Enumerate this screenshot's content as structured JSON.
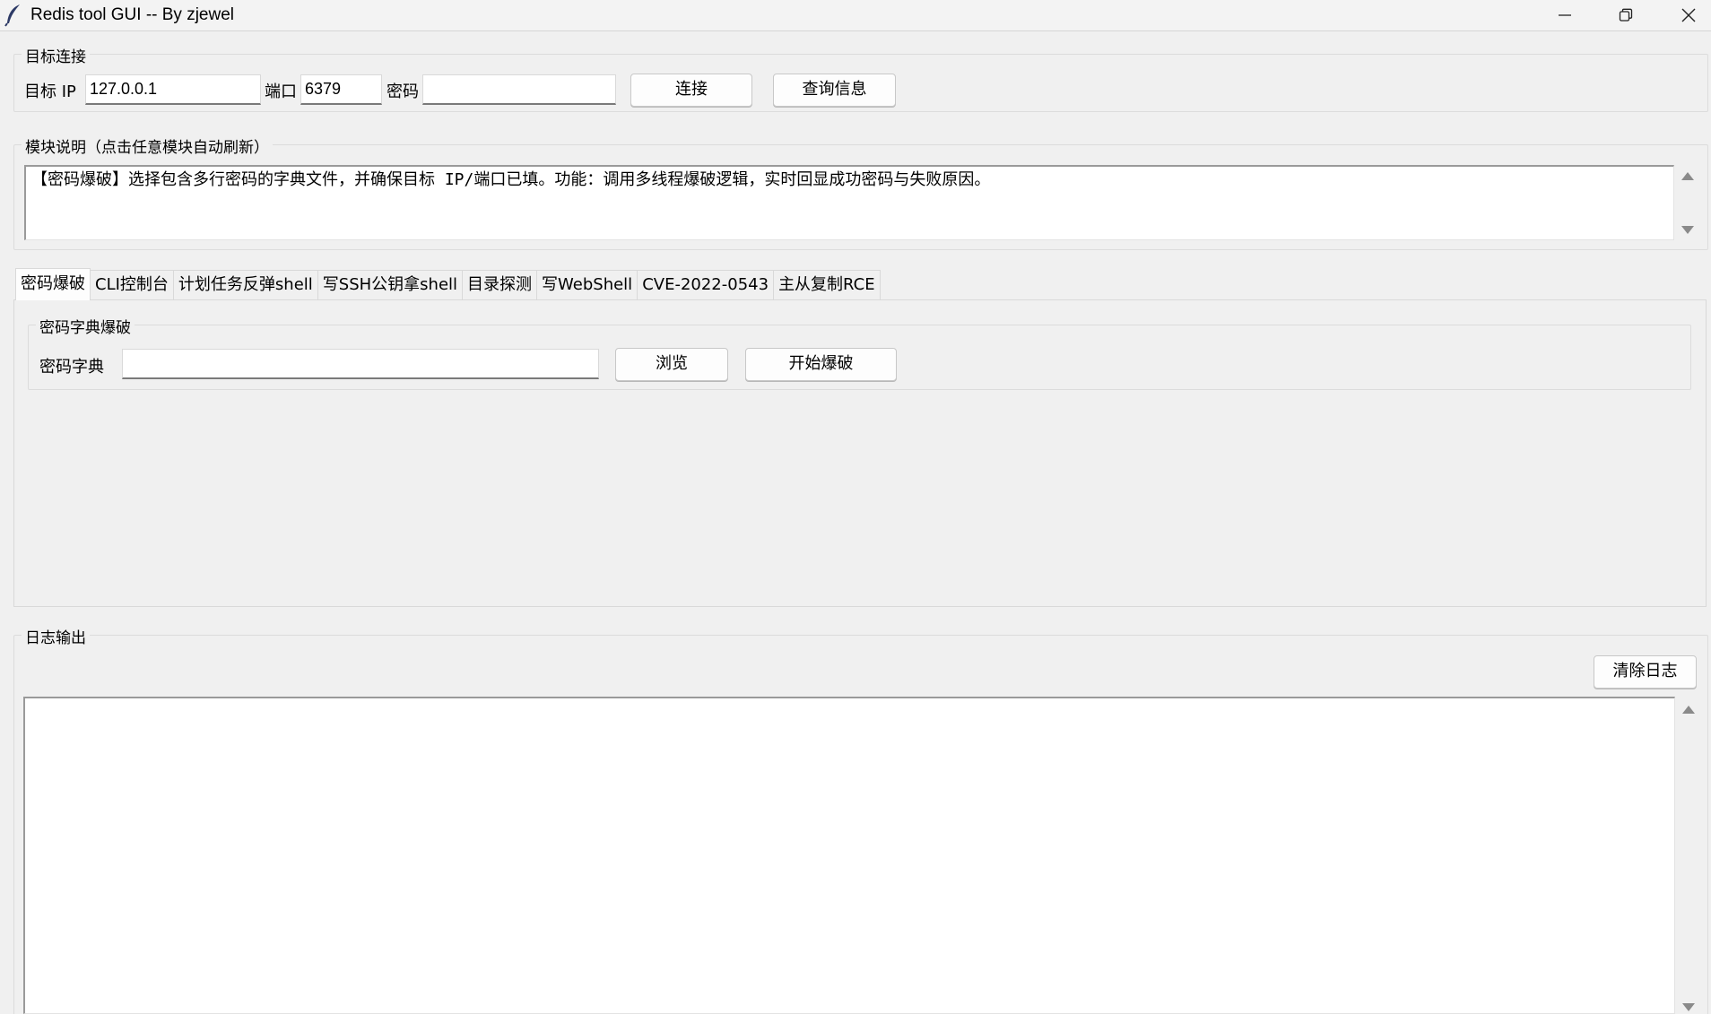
{
  "window": {
    "title": "Redis tool GUI -- By zjewel"
  },
  "connection": {
    "legend": "目标连接",
    "ip_label": "目标 IP",
    "ip_value": "127.0.0.1",
    "port_label": "端口",
    "port_value": "6379",
    "password_label": "密码",
    "password_value": "",
    "connect_button": "连接",
    "info_button": "查询信息"
  },
  "module_info": {
    "legend": "模块说明（点击任意模块自动刷新）",
    "text": "【密码爆破】选择包含多行密码的字典文件，并确保目标 IP/端口已填。功能：调用多线程爆破逻辑，实时回显成功密码与失败原因。"
  },
  "tabs": [
    {
      "label": "密码爆破",
      "active": true
    },
    {
      "label": "CLI控制台",
      "active": false
    },
    {
      "label": "计划任务反弹shell",
      "active": false
    },
    {
      "label": "写SSH公钥拿shell",
      "active": false
    },
    {
      "label": "目录探测",
      "active": false
    },
    {
      "label": "写WebShell",
      "active": false
    },
    {
      "label": "CVE-2022-0543",
      "active": false
    },
    {
      "label": "主从复制RCE",
      "active": false
    }
  ],
  "brute": {
    "legend": "密码字典爆破",
    "dict_label": "密码字典",
    "dict_value": "",
    "browse_button": "浏览",
    "start_button": "开始爆破"
  },
  "log": {
    "legend": "日志输出",
    "clear_button": "清除日志",
    "content": ""
  },
  "icons": {
    "app": "feather-icon",
    "minimize": "minimize-icon",
    "maximize": "restore-icon",
    "close": "close-icon"
  }
}
